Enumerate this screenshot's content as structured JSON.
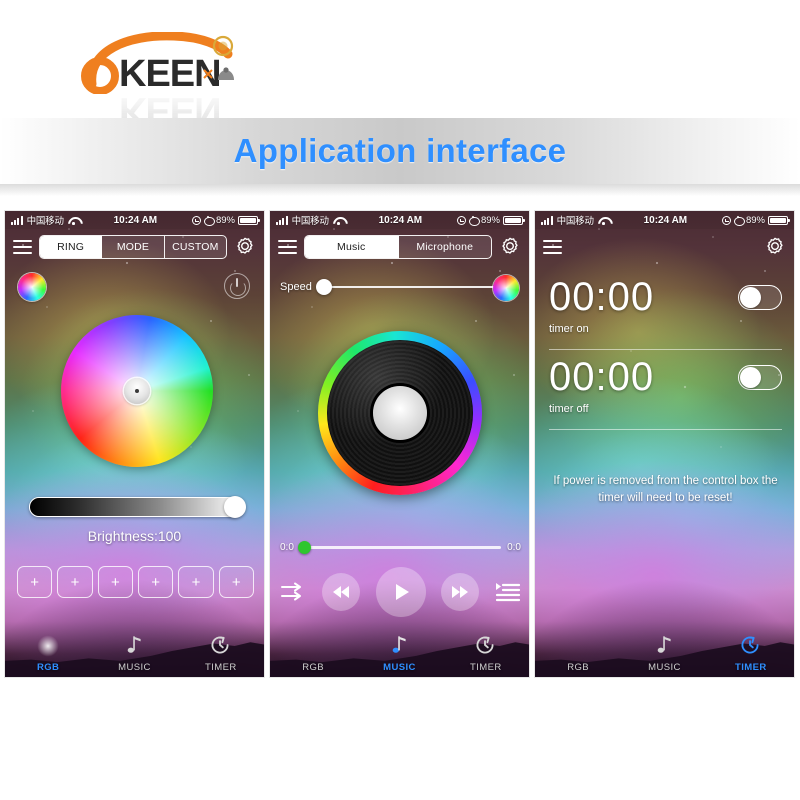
{
  "brand": {
    "name": "OKEEN",
    "logo_icon": "okeen-logo"
  },
  "banner": {
    "title": "Application interface",
    "title_color": "#2f8fff"
  },
  "status_bar": {
    "carrier": "中国移动",
    "time": "10:24 AM",
    "battery_percent": "89%",
    "signal_icon": "signal-bars-icon",
    "wifi_icon": "wifi-icon",
    "rotation_lock_icon": "rotation-lock-icon",
    "alarm_icon": "alarm-clock-icon",
    "battery_icon": "battery-icon"
  },
  "phones": [
    {
      "id": "rgb",
      "menu_icon": "hamburger-menu-icon",
      "settings_icon": "gear-icon",
      "segments": [
        {
          "label": "RING",
          "active": true
        },
        {
          "label": "MODE",
          "active": false
        },
        {
          "label": "CUSTOM",
          "active": false
        }
      ],
      "mini_wheel_icon": "color-wheel-icon",
      "power_icon": "power-button-icon",
      "color_wheel_icon": "color-wheel-large",
      "brightness": {
        "label": "Brightness:100",
        "value": 100
      },
      "presets": [
        "+",
        "+",
        "+",
        "+",
        "+",
        "+"
      ],
      "tabs": [
        {
          "label": "RGB",
          "icon": "rgb-wheel-icon",
          "active": true
        },
        {
          "label": "MUSIC",
          "icon": "music-note-icon",
          "active": false
        },
        {
          "label": "TIMER",
          "icon": "timer-icon",
          "active": false
        }
      ]
    },
    {
      "id": "music",
      "menu_icon": "hamburger-menu-icon",
      "settings_icon": "gear-icon",
      "segments": [
        {
          "label": "Music",
          "active": true
        },
        {
          "label": "Microphone",
          "active": false
        }
      ],
      "speed": {
        "label": "Speed",
        "value": "0"
      },
      "mini_wheel_icon": "color-wheel-icon",
      "vinyl_icon": "vinyl-record-icon",
      "track": {
        "elapsed": "0:0",
        "remaining": "0:0"
      },
      "controls": [
        {
          "icon": "shuffle-icon",
          "name": "shuffle-button"
        },
        {
          "icon": "previous-icon",
          "name": "previous-button"
        },
        {
          "icon": "play-icon",
          "name": "play-button"
        },
        {
          "icon": "next-icon",
          "name": "next-button"
        },
        {
          "icon": "playlist-icon",
          "name": "playlist-button"
        }
      ],
      "tabs": [
        {
          "label": "RGB",
          "icon": "rgb-wheel-icon",
          "active": false
        },
        {
          "label": "MUSIC",
          "icon": "music-note-icon",
          "active": true
        },
        {
          "label": "TIMER",
          "icon": "timer-icon",
          "active": false
        }
      ]
    },
    {
      "id": "timer",
      "menu_icon": "hamburger-menu-icon",
      "settings_icon": "gear-icon",
      "timers": [
        {
          "time": "00:00",
          "label": "timer on",
          "enabled": false
        },
        {
          "time": "00:00",
          "label": "timer off",
          "enabled": false
        }
      ],
      "note": "If power is removed from the control box the timer will need to be reset!",
      "tabs": [
        {
          "label": "RGB",
          "icon": "rgb-wheel-icon",
          "active": false
        },
        {
          "label": "MUSIC",
          "icon": "music-note-icon",
          "active": false
        },
        {
          "label": "TIMER",
          "icon": "timer-icon",
          "active": true
        }
      ]
    }
  ]
}
